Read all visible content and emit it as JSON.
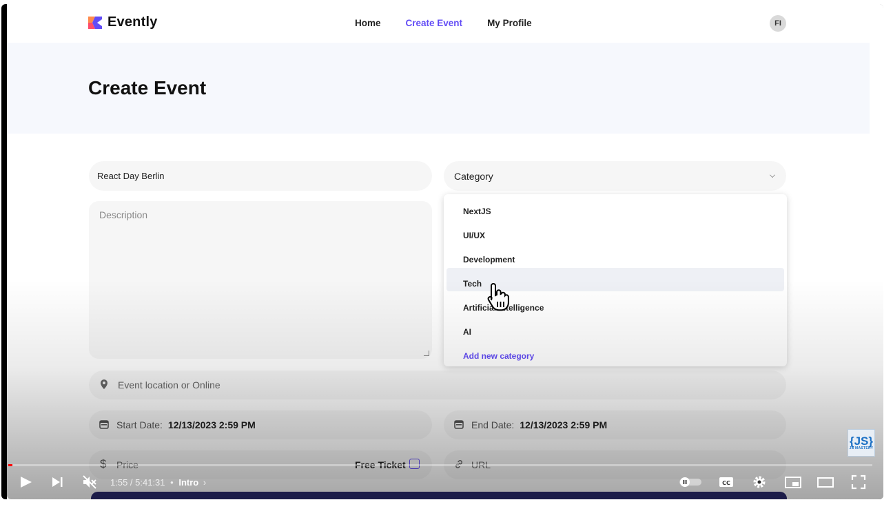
{
  "app": {
    "name": "Evently",
    "user_initials": "FI",
    "accent": "#624cf5"
  },
  "nav": {
    "items": [
      "Home",
      "Create Event",
      "My Profile"
    ],
    "active": "Create Event"
  },
  "page": {
    "title": "Create Event"
  },
  "form": {
    "title_value": "React Day Berlin",
    "category_placeholder": "Category",
    "description_placeholder": "Description",
    "location_placeholder": "Event location or Online",
    "start_label": "Start Date:",
    "start_value": "12/13/2023 2:59 PM",
    "end_label": "End Date:",
    "end_value": "12/13/2023 2:59 PM",
    "price_placeholder": "Price",
    "free_ticket_label": "Free Ticket",
    "url_placeholder": "URL"
  },
  "dropdown": {
    "options": [
      "NextJS",
      "UI/UX",
      "Development",
      "Tech",
      "Artificial Intelligence",
      "AI"
    ],
    "highlighted": "Tech",
    "add_label": "Add new category"
  },
  "player": {
    "time": "1:55 / 5:41:31",
    "chapter": "Intro",
    "watermark": "JS MASTERY",
    "icons": [
      "play-icon",
      "next-icon",
      "mute-icon",
      "autoplay-toggle-icon",
      "captions-icon",
      "settings-icon",
      "miniplayer-icon",
      "theater-icon",
      "fullscreen-icon"
    ]
  }
}
